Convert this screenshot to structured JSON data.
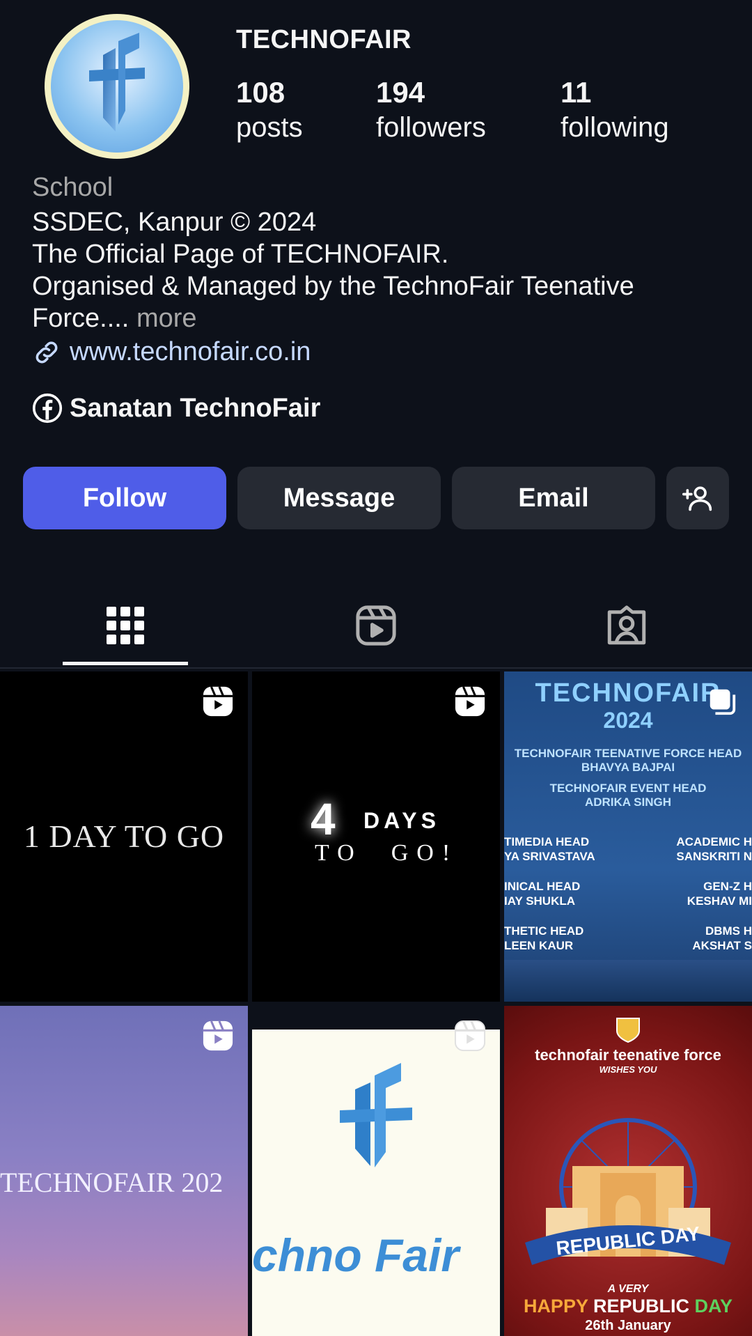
{
  "profile": {
    "username": "TECHNOFAIR",
    "avatar_letters": "tf",
    "stats": [
      {
        "value": "108",
        "label": "posts"
      },
      {
        "value": "194",
        "label": "followers"
      },
      {
        "value": "11",
        "label": "following"
      }
    ],
    "category": "School",
    "bio_lines": [
      "SSDEC, Kanpur © 2024",
      "The Official Page of TECHNOFAIR.",
      "Organised & Managed by the TechnoFair Teenative",
      "Force...."
    ],
    "more_label": "more",
    "website": "www.technofair.co.in",
    "facebook_name": "Sanatan TechnoFair"
  },
  "actions": {
    "follow": "Follow",
    "message": "Message",
    "email": "Email",
    "suggest_icon": "add-person-icon"
  },
  "tabs": [
    {
      "icon": "grid-icon",
      "active": true
    },
    {
      "icon": "reels-icon",
      "active": false
    },
    {
      "icon": "tagged-icon",
      "active": false
    }
  ],
  "posts": {
    "p1": {
      "text": "1 DAY TO GO",
      "badge": "reel-icon"
    },
    "p2": {
      "big": "4",
      "line1": "DAYS",
      "line2": "TO  GO!",
      "badge": "reel-icon"
    },
    "p3": {
      "badge": "carousel-icon",
      "title": "TECHNOFAIR",
      "year": "2024",
      "rows": [
        "TECHNOFAIR TEENATIVE FORCE HEAD",
        "BHAVYA BAJPAI",
        "TECHNOFAIR EVENT HEAD",
        "ADRIKA SINGH"
      ],
      "left_col": [
        "TIMEDIA HEAD",
        "YA SRIVASTAVA",
        "INICAL HEAD",
        "IAY SHUKLA",
        "THETIC HEAD",
        "LEEN KAUR"
      ],
      "right_col": [
        "ACADEMIC H",
        "SANSKRITI N",
        "GEN-Z H",
        "KESHAV MI",
        "DBMS H",
        "AKSHAT S"
      ]
    },
    "p4": {
      "text": "TECHNOFAIR 202",
      "badge": "reel-icon"
    },
    "p5": {
      "letters": "tf",
      "text": "chno Fair",
      "badge": "reel-icon"
    },
    "p6": {
      "line1": "technofair teenative force",
      "line2": "WISHES YOU",
      "banner": "REPUBLIC DAY",
      "line3": "A VERY",
      "line4a": "HAPPY",
      "line4b": "REPUBLIC",
      "line4c": "DAY",
      "date": "26th January"
    }
  },
  "colors": {
    "background": "#0d111a",
    "follow_button": "#4f5de8",
    "secondary_button": "#262a33",
    "link": "#c6d9ff"
  }
}
